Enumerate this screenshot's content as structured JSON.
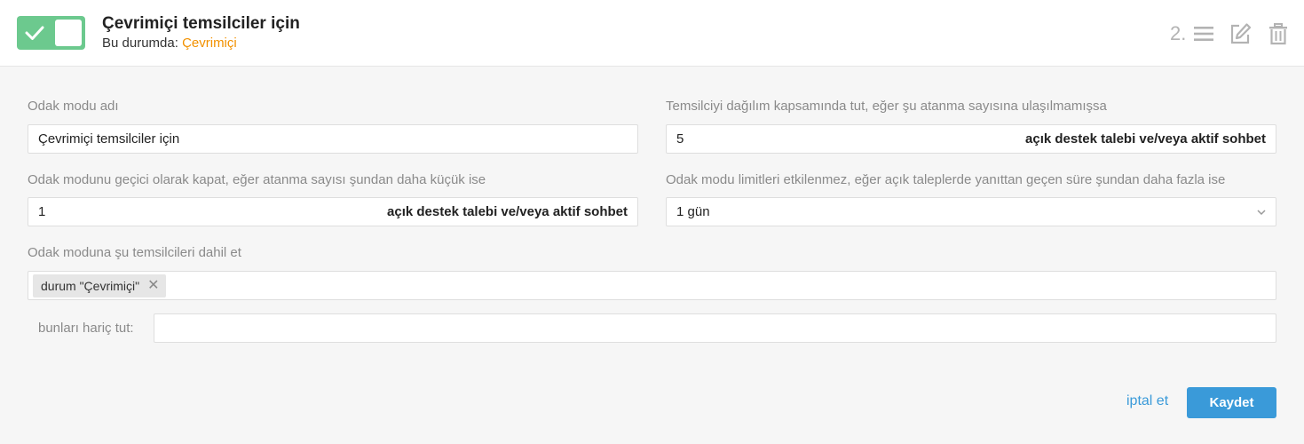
{
  "header": {
    "title": "Çevrimiçi temsilciler için",
    "subtitle_prefix": "Bu durumda:",
    "subtitle_status": "Çevrimiçi",
    "order_number": "2.",
    "toggle_on": true,
    "icons": [
      "reorder-icon",
      "edit-icon",
      "trash-icon"
    ]
  },
  "form": {
    "name_label": "Odak modu adı",
    "name_value": "Çevrimiçi temsilciler için",
    "keep_label": "Temsilciyi dağılım kapsamında tut, eğer şu atanma sayısına ulaşılmamışsa",
    "keep_value": "5",
    "keep_suffix": "açık destek talebi ve/veya aktif sohbet",
    "pause_label": "Odak modunu geçici olarak kapat, eğer atanma sayısı şundan daha küçük ise",
    "pause_value": "1",
    "pause_suffix": "açık destek talebi ve/veya aktif sohbet",
    "limit_label": "Odak modu limitleri etkilenmez, eğer açık taleplerde yanıttan geçen süre şundan daha fazla ise",
    "limit_value": "1 gün",
    "include_label": "Odak moduna şu temsilcileri dahil et",
    "include_tag": "durum \"Çevrimiçi\"",
    "tag_remove": "✕",
    "exclude_label": "bunları hariç tut:",
    "exclude_value": ""
  },
  "actions": {
    "cancel_label": "iptal et",
    "save_label": "Kaydet"
  },
  "colors": {
    "toggle": "#6cc98e",
    "status": "#f29100",
    "primary": "#3a9ad9",
    "icon": "#b3b3b3"
  }
}
